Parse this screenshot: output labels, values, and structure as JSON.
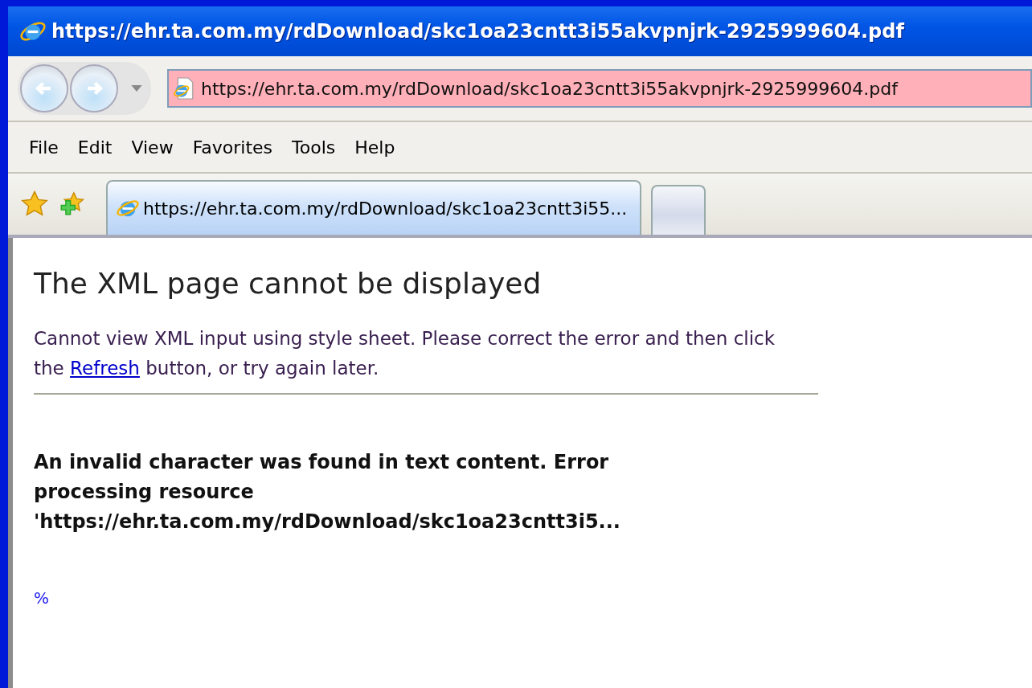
{
  "window": {
    "title": "https://ehr.ta.com.my/rdDownload/skc1oa23cntt3i55akvpnjrk-2925999604.pdf"
  },
  "address_bar": {
    "value": "https://ehr.ta.com.my/rdDownload/skc1oa23cntt3i55akvpnjrk-2925999604.pdf",
    "certificate_error": true
  },
  "menu": [
    {
      "label": "File"
    },
    {
      "label": "Edit"
    },
    {
      "label": "View"
    },
    {
      "label": "Favorites"
    },
    {
      "label": "Tools"
    },
    {
      "label": "Help"
    }
  ],
  "tabs": [
    {
      "label": "https://ehr.ta.com.my/rdDownload/skc1oa23cntt3i55...",
      "selected": true
    }
  ],
  "page": {
    "heading": "The XML page cannot be displayed",
    "message": {
      "before": "Cannot view XML input using style sheet. Please correct the error and then click the ",
      "link": "Refresh",
      "after": " button, or try again later."
    },
    "error": "An invalid character was found in text content. Error processing resource",
    "resource": "'https://ehr.ta.com.my/rdDownload/skc1oa23cntt3i5...",
    "source": "%"
  }
}
